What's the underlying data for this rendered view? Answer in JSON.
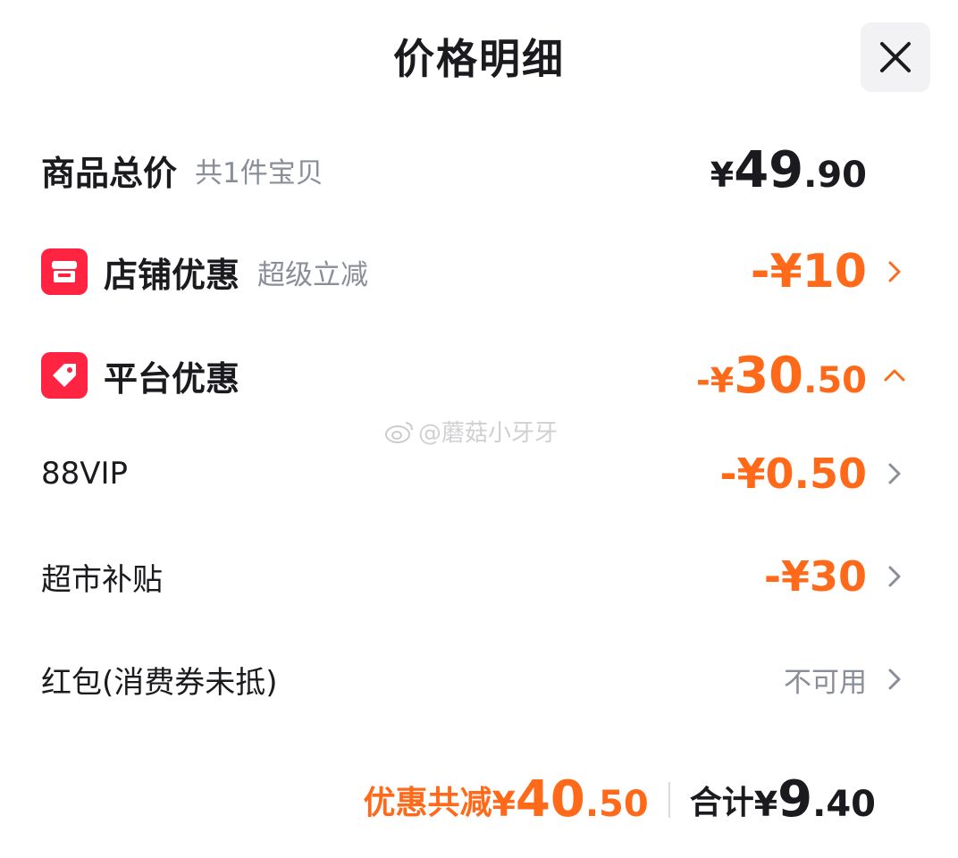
{
  "header": {
    "title": "价格明细"
  },
  "goods_total": {
    "label": "商品总价",
    "sub": "共1件宝贝",
    "currency": "¥",
    "amount_int": "49",
    "amount_dec": ".90"
  },
  "store_discount": {
    "icon": "store-icon",
    "label": "店铺优惠",
    "sub": "超级立减",
    "amount": "-¥10"
  },
  "platform_discount": {
    "icon": "tag-icon",
    "label": "平台优惠",
    "amount_prefix": "-¥",
    "amount_int": "30",
    "amount_dec": ".50",
    "expanded": true
  },
  "platform_items": [
    {
      "label": "88VIP",
      "amount": "-¥0.50"
    },
    {
      "label": "超市补贴",
      "amount": "-¥30"
    },
    {
      "label": "红包(消费券未抵)",
      "value": "不可用"
    }
  ],
  "watermark": "@蘑菇小牙牙",
  "footer": {
    "discount_label": "优惠共减",
    "discount_currency": "¥",
    "discount_int": "40",
    "discount_dec": ".50",
    "total_label": "合计",
    "total_currency": "¥",
    "total_int": "9",
    "total_dec": ".40"
  },
  "colors": {
    "accent_orange": "#ff6a1a",
    "brand_red": "#ff2442",
    "text_dark": "#1b1b1f",
    "text_gray": "#8a8e99"
  }
}
